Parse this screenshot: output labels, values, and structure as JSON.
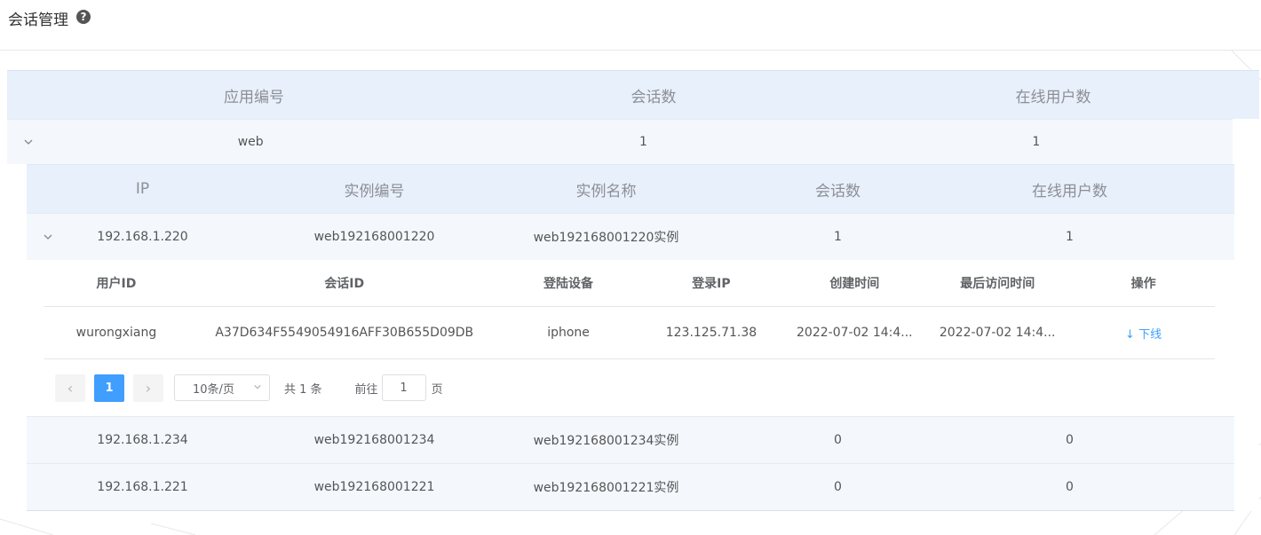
{
  "page": {
    "title": "会话管理",
    "help_icon": "question-circle-icon"
  },
  "level1": {
    "headers": [
      "应用编号",
      "会话数",
      "在线用户数"
    ],
    "row": {
      "app_id": "web",
      "sessions": "1",
      "online_users": "1",
      "expand_icon": "chevron-down-icon"
    }
  },
  "level2": {
    "headers": [
      "IP",
      "实例编号",
      "实例名称",
      "会话数",
      "在线用户数"
    ],
    "rows": [
      {
        "ip": "192.168.1.220",
        "instance_id": "web192168001220",
        "instance_name": "web192168001220实例",
        "sessions": "1",
        "online_users": "1"
      },
      {
        "ip": "192.168.1.234",
        "instance_id": "web192168001234",
        "instance_name": "web192168001234实例",
        "sessions": "0",
        "online_users": "0"
      },
      {
        "ip": "192.168.1.221",
        "instance_id": "web192168001221",
        "instance_name": "web192168001221实例",
        "sessions": "0",
        "online_users": "0"
      }
    ]
  },
  "level3": {
    "headers": [
      "用户ID",
      "会话ID",
      "登陆设备",
      "登录IP",
      "创建时间",
      "最后访问时间",
      "操作"
    ],
    "rows": [
      {
        "user_id": "wurongxiang",
        "session_id": "A37D634F5549054916AFF30B655D09DB",
        "device": "iphone",
        "login_ip": "123.125.71.38",
        "created": "2022-07-02 14:4...",
        "last_access": "2022-07-02 14:4...",
        "action_icon": "arrow-down-icon",
        "action_label": "下线"
      }
    ],
    "pagination": {
      "prev_icon": "chevron-left-icon",
      "next_icon": "chevron-right-icon",
      "current_page": "1",
      "page_size": "10条/页",
      "total": "共 1 条",
      "goto_label": "前往",
      "goto_value": "1",
      "page_suffix": "页"
    }
  },
  "colors": {
    "accent": "#409eff",
    "header_bg": "#e8f0fb",
    "row_bg": "#f4f8fd"
  }
}
